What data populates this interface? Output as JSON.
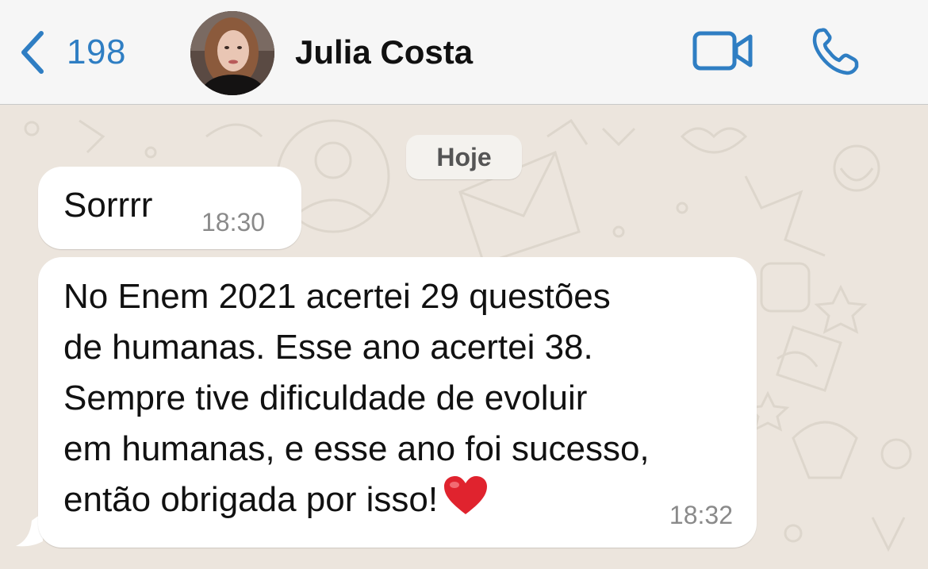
{
  "header": {
    "back_count": "198",
    "contact_name": "Julia Costa",
    "icons": {
      "back": "chevron-left-icon",
      "video": "video-camera-icon",
      "call": "phone-icon"
    },
    "accent_color": "#2f7ec3"
  },
  "chat": {
    "date_label": "Hoje",
    "messages": [
      {
        "text": "Sorrrr",
        "time": "18:30"
      },
      {
        "text": "No Enem 2021 acertei 29 questões\nde humanas. Esse ano acertei 38.\nSempre tive dificuldade de evoluir\nem humanas, e esse ano foi sucesso,\nentão obrigada por isso!",
        "emoji": "red-heart-icon",
        "time": "18:32"
      }
    ],
    "bubble_color": "#ffffff",
    "background_color": "#ece5dd"
  }
}
